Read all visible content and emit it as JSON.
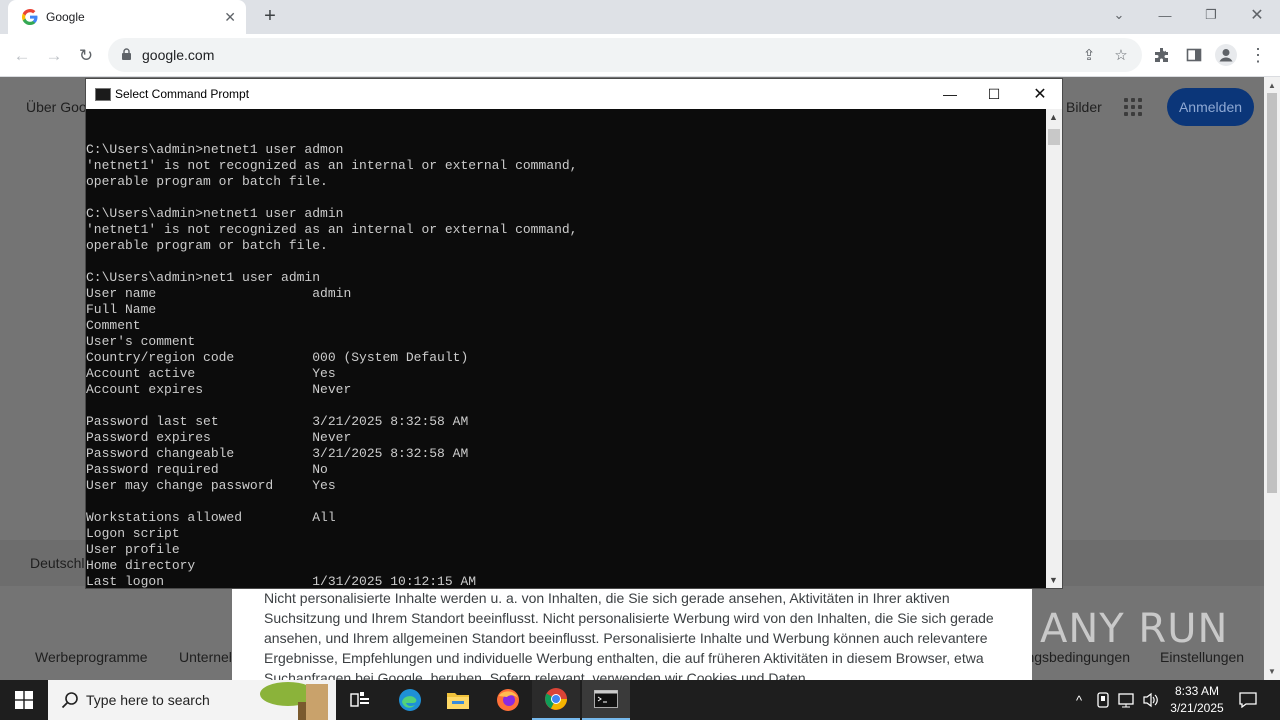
{
  "browser": {
    "tab_title": "Google",
    "url": "google.com"
  },
  "page": {
    "about_link": "Über Google",
    "images_link": "Bilder",
    "signin_label": "Anmelden",
    "region": "Deutschland",
    "footer_links": [
      "Werbeprogramme",
      "Unternehmen",
      "Nutzungsbedingungen",
      "Einstellungen"
    ],
    "consent_text": "Nicht personalisierte Inhalte werden u. a. von Inhalten, die Sie sich gerade ansehen, Aktivitäten in Ihrer aktiven Suchsitzung und Ihrem Standort beeinflusst. Nicht personalisierte Werbung wird von den Inhalten, die Sie sich gerade ansehen, und Ihrem allgemeinen Standort beeinflusst. Personalisierte Inhalte und Werbung können auch relevantere Ergebnisse, Empfehlungen und individuelle Werbung enthalten, die auf früheren Aktivitäten in diesem Browser, etwa Suchanfragen bei Google, beruhen. Sofern relevant, verwenden wir Cookies und Daten",
    "watermark": "ANY RUN"
  },
  "cmd": {
    "title": "Select Command Prompt",
    "lines": [
      "C:\\Users\\admin>netnet1 user admon",
      "'netnet1' is not recognized as an internal or external command,",
      "operable program or batch file.",
      "",
      "C:\\Users\\admin>netnet1 user admin",
      "'netnet1' is not recognized as an internal or external command,",
      "operable program or batch file.",
      "",
      "C:\\Users\\admin>net1 user admin",
      "User name                    admin",
      "Full Name",
      "Comment",
      "User's comment",
      "Country/region code          000 (System Default)",
      "Account active               Yes",
      "Account expires              Never",
      "",
      "Password last set            3/21/2025 8:32:58 AM",
      "Password expires             Never",
      "Password changeable          3/21/2025 8:32:58 AM",
      "Password required            No",
      "User may change password     Yes",
      "",
      "Workstations allowed         All",
      "Logon script",
      "User profile",
      "Home directory",
      "Last logon                   1/31/2025 10:12:15 AM"
    ]
  },
  "taskbar": {
    "search_placeholder": "Type here to search",
    "time": "8:33 AM",
    "date": "3/21/2025"
  }
}
